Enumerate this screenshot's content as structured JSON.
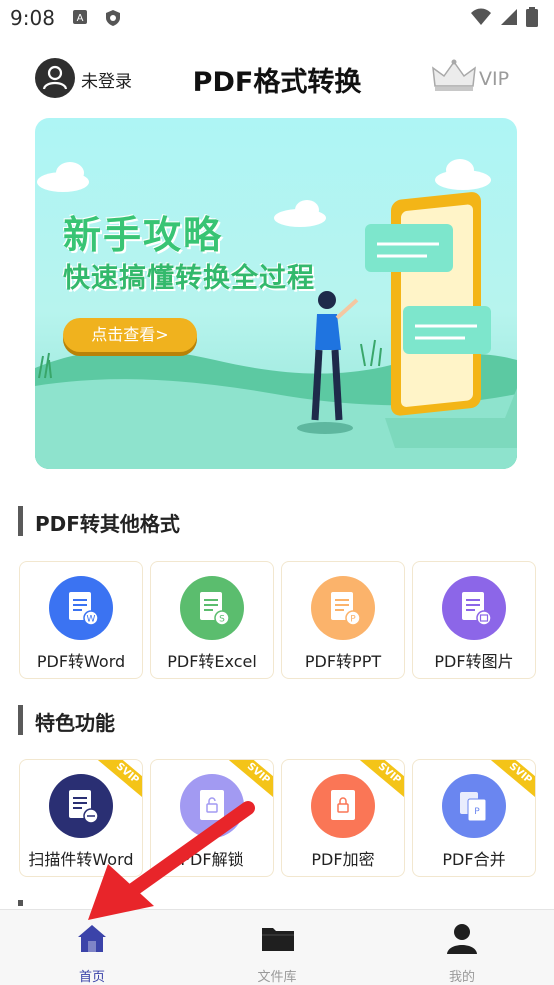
{
  "status_bar": {
    "time": "9:08",
    "icons": [
      "a-icon",
      "shield-icon",
      "wifi-icon",
      "signal-icon",
      "battery-icon"
    ]
  },
  "header": {
    "login_status": "未登录",
    "title": "PDF格式转换",
    "vip_label": "VIP"
  },
  "banner": {
    "title": "新手攻略",
    "subtitle": "快速搞懂转换全过程",
    "button_label": "点击查看>"
  },
  "sections": {
    "convert": {
      "title": "PDF转其他格式",
      "items": [
        {
          "label": "PDF转Word",
          "icon": "word-doc-icon",
          "color": "#3b73f2",
          "badge": "W"
        },
        {
          "label": "PDF转Excel",
          "icon": "excel-doc-icon",
          "color": "#5bbd6e",
          "badge": "S"
        },
        {
          "label": "PDF转PPT",
          "icon": "ppt-doc-icon",
          "color": "#fbb36b",
          "badge": "P"
        },
        {
          "label": "PDF转图片",
          "icon": "image-doc-icon",
          "color": "#8c66e8",
          "badge": ""
        }
      ]
    },
    "features": {
      "title": "特色功能",
      "items": [
        {
          "label": "扫描件转Word",
          "icon": "scan-icon",
          "color": "#2a2f73",
          "svip": "SVIP"
        },
        {
          "label": "PDF解锁",
          "icon": "unlock-icon",
          "color": "#a29af2",
          "svip": "SVIP"
        },
        {
          "label": "PDF加密",
          "icon": "lock-icon",
          "color": "#fa7656",
          "svip": "SVIP"
        },
        {
          "label": "PDF合并",
          "icon": "merge-icon",
          "color": "#6a86f0",
          "svip": "SVIP"
        }
      ]
    }
  },
  "bottom_nav": [
    {
      "label": "首页",
      "icon": "home-icon",
      "active": true
    },
    {
      "label": "文件库",
      "icon": "folder-icon",
      "active": false
    },
    {
      "label": "我的",
      "icon": "person-icon",
      "active": false
    }
  ],
  "colors": {
    "accent": "#3b43a9",
    "arrow": "#e8252a",
    "banner_green": "#38c474",
    "button_yellow": "#f0b21e"
  }
}
